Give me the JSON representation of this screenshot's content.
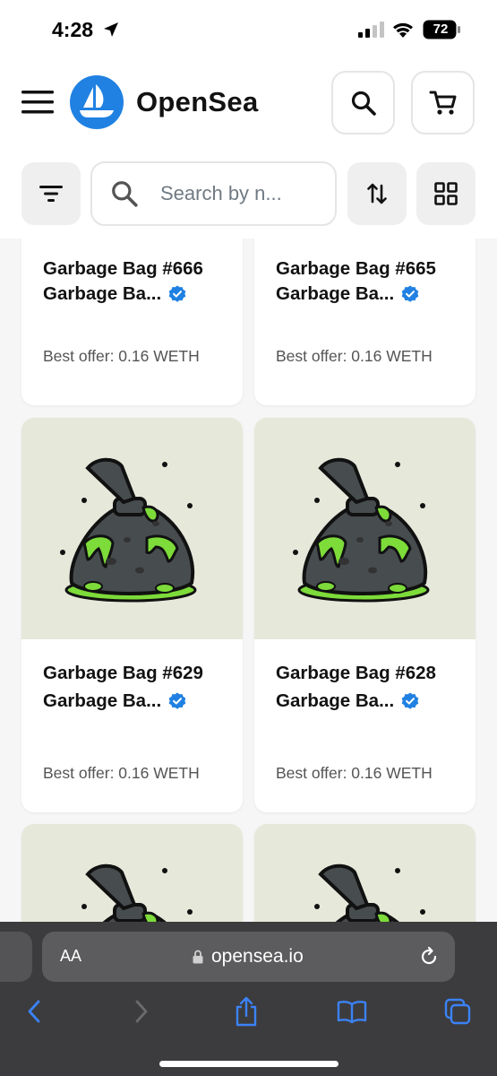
{
  "status": {
    "time": "4:28",
    "battery": "72"
  },
  "header": {
    "brand": "OpenSea"
  },
  "search": {
    "placeholder": "Search by n..."
  },
  "cards": [
    {
      "title": "Garbage Bag #666",
      "collection": "Garbage Ba...",
      "offer": "Best offer: 0.16 WETH"
    },
    {
      "title": "Garbage Bag #665",
      "collection": "Garbage Ba...",
      "offer": "Best offer: 0.16 WETH"
    },
    {
      "title": "Garbage Bag #629",
      "collection": "Garbage Ba...",
      "offer": "Best offer: 0.16 WETH"
    },
    {
      "title": "Garbage Bag #628",
      "collection": "Garbage Ba...",
      "offer": "Best offer: 0.16 WETH"
    }
  ],
  "browser": {
    "aa": "AA",
    "url": "opensea.io"
  },
  "icons": {
    "menu": "menu-icon",
    "logo": "opensea-logo-icon",
    "search": "search-icon",
    "cart": "cart-icon",
    "filter": "filter-icon",
    "sort": "sort-icon",
    "grid": "grid-view-icon",
    "verified": "verified-badge-icon",
    "back": "back-icon",
    "forward": "forward-icon",
    "share": "share-icon",
    "bookmarks": "bookmarks-icon",
    "tabs": "tabs-icon"
  },
  "colors": {
    "accent": "#2081e2",
    "nft_bg": "#e6e8da",
    "slime": "#7ddb3a",
    "bag": "#474c4e",
    "safari_bar": "#3c3c3e",
    "safari_blue": "#3b82f6"
  }
}
